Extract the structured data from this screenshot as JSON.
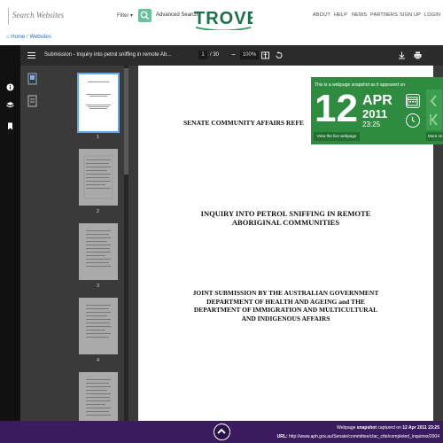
{
  "header": {
    "search_placeholder": "Search Websites",
    "filter_label": "Filter",
    "advanced_search": "Advanced Search",
    "logo_text": "TROVE",
    "nav": [
      "ABOUT",
      "HELP",
      "NEWS",
      "PARTNERS",
      "SIGN UP",
      "LOGIN"
    ]
  },
  "breadcrumb": {
    "home": "Home",
    "separator": "/",
    "section": "Websites"
  },
  "viewer": {
    "doc_title": "Submission - Inquiry into petrol sniffing in remote Ab...",
    "page_current": "1",
    "page_total": "/ 30",
    "zoom": "100%",
    "thumbnails": [
      "1",
      "2",
      "3",
      "4"
    ]
  },
  "page": {
    "heading1": "SENATE COMMUNITY AFFAIRS REFE",
    "heading2_line1": "INQUIRY INTO PETROL SNIFFING IN REMOTE",
    "heading2_line2": "ABORIGINAL COMMUNITIES",
    "heading3_line1": "JOINT SUBMISSION BY THE AUSTRALIAN GOVERNMENT",
    "heading3_line2": "DEPARTMENT OF HEALTH AND AGEING and THE",
    "heading3_line3": "DEPARTMENT OF IMMIGRATION AND MULTICULTURAL",
    "heading3_line4": "AND INDIGENOUS AFFAIRS"
  },
  "snapshot": {
    "intro": "This is a webpage snapshot as it appeared on",
    "day": "12",
    "month": "APR",
    "year": "2011",
    "time": "23:25",
    "live_button": "View the live webpage",
    "more_button": "More sn"
  },
  "footer": {
    "line1_prefix": "Webpage ",
    "line1_bold": "snapshot",
    "line1_mid": " captured on ",
    "line1_date": "12 Apr 2011 23:25",
    "url_label": "URL:",
    "url": "http://www.aph.gov.au/Senate/committee/clac_ctte/completed_inquiries/2004"
  },
  "colors": {
    "brand_green": "#2e8b40",
    "footer_purple": "#3a1c5e",
    "accent_blue": "#1e76c9"
  }
}
